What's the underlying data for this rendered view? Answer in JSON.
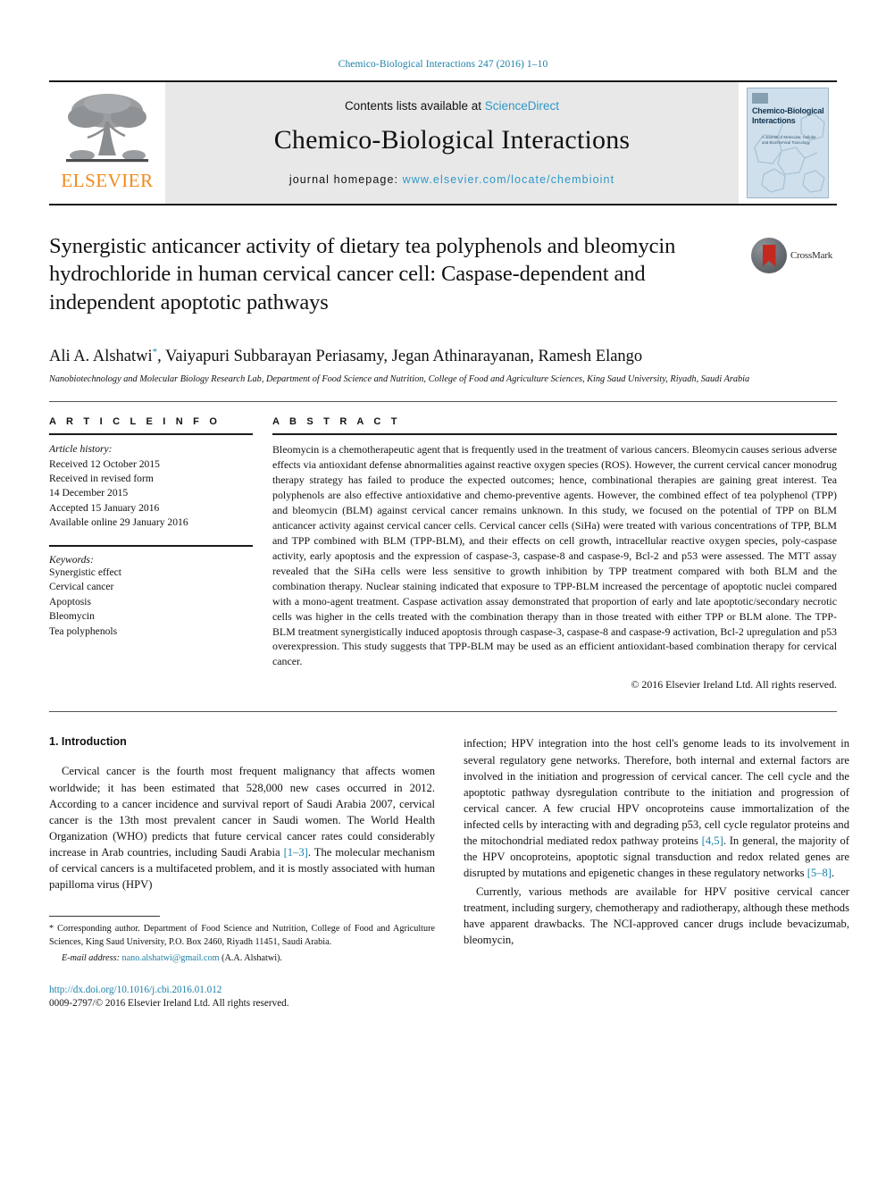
{
  "running_head": "Chemico-Biological Interactions 247 (2016) 1–10",
  "masthead": {
    "contents_prefix": "Contents lists available at ",
    "sciencedirect": "ScienceDirect",
    "journal_name": "Chemico-Biological Interactions",
    "homepage_prefix": "journal homepage: ",
    "homepage_url": "www.elsevier.com/locate/chembioint",
    "publisher": "ELSEVIER",
    "cover_title": "Chemico-Biological Interactions",
    "cover_subtitle": "A Journal of Molecular, Cellular and Biochemical Toxicology",
    "link_color": "#2f97c7",
    "publisher_color": "#f08a1a"
  },
  "article": {
    "title": "Synergistic anticancer activity of dietary tea polyphenols and bleomycin hydrochloride in human cervical cancer cell: Caspase-dependent and independent apoptotic pathways",
    "authors": "Ali A. Alshatwi, Vaiyapuri Subbarayan Periasamy, Jegan Athinarayanan, Ramesh Elango",
    "author_marker": "*",
    "affiliation": "Nanobiotechnology and Molecular Biology Research Lab, Department of Food Science and Nutrition, College of Food and Agriculture Sciences, King Saud University, Riyadh, Saudi Arabia",
    "crossmark_label": "CrossMark"
  },
  "article_info": {
    "heading": "A R T I C L E   I N F O",
    "history_label": "Article history:",
    "history": [
      "Received 12 October 2015",
      "Received in revised form",
      "14 December 2015",
      "Accepted 15 January 2016",
      "Available online 29 January 2016"
    ],
    "keywords_label": "Keywords:",
    "keywords": [
      "Synergistic effect",
      "Cervical cancer",
      "Apoptosis",
      "Bleomycin",
      "Tea polyphenols"
    ]
  },
  "abstract": {
    "heading": "A B S T R A C T",
    "text": "Bleomycin is a chemotherapeutic agent that is frequently used in the treatment of various cancers. Bleomycin causes serious adverse effects via antioxidant defense abnormalities against reactive oxygen species (ROS). However, the current cervical cancer monodrug therapy strategy has failed to produce the expected outcomes; hence, combinational therapies are gaining great interest. Tea polyphenols are also effective antioxidative and chemo-preventive agents. However, the combined effect of tea polyphenol (TPP) and bleomycin (BLM) against cervical cancer remains unknown. In this study, we focused on the potential of TPP on BLM anticancer activity against cervical cancer cells. Cervical cancer cells (SiHa) were treated with various concentrations of TPP, BLM and TPP combined with BLM (TPP-BLM), and their effects on cell growth, intracellular reactive oxygen species, poly-caspase activity, early apoptosis and the expression of caspase-3, caspase-8 and caspase-9, Bcl-2 and p53 were assessed. The MTT assay revealed that the SiHa cells were less sensitive to growth inhibition by TPP treatment compared with both BLM and the combination therapy. Nuclear staining indicated that exposure to TPP-BLM increased the percentage of apoptotic nuclei compared with a mono-agent treatment. Caspase activation assay demonstrated that proportion of early and late apoptotic/secondary necrotic cells was higher in the cells treated with the combination therapy than in those treated with either TPP or BLM alone. The TPP-BLM treatment synergistically induced apoptosis through caspase-3, caspase-8 and caspase-9 activation, Bcl-2 upregulation and p53 overexpression. This study suggests that TPP-BLM may be used as an efficient antioxidant-based combination therapy for cervical cancer.",
    "copyright": "© 2016 Elsevier Ireland Ltd. All rights reserved."
  },
  "introduction": {
    "heading": "1. Introduction",
    "left_para_1": "Cervical cancer is the fourth most frequent malignancy that affects women worldwide; it has been estimated that 528,000 new cases occurred in 2012. According to a cancer incidence and survival report of Saudi Arabia 2007, cervical cancer is the 13th most prevalent cancer in Saudi women. The World Health Organization (WHO) predicts that future cervical cancer rates could considerably increase in Arab countries, including Saudi Arabia ",
    "left_ref_1": "[1–3]",
    "left_para_1b": ". The molecular mechanism of cervical cancers is a multifaceted problem, and it is mostly associated with human papilloma virus (HPV)",
    "right_para_1": "infection; HPV integration into the host cell's genome leads to its involvement in several regulatory gene networks. Therefore, both internal and external factors are involved in the initiation and progression of cervical cancer. The cell cycle and the apoptotic pathway dysregulation contribute to the initiation and progression of cervical cancer. A few crucial HPV oncoproteins cause immortalization of the infected cells by interacting with and degrading p53, cell cycle regulator proteins and the mitochondrial mediated redox pathway proteins ",
    "right_ref_1": "[4,5]",
    "right_para_1b": ". In general, the majority of the HPV oncoproteins, apoptotic signal transduction and redox related genes are disrupted by mutations and epigenetic changes in these regulatory networks ",
    "right_ref_2": "[5–8]",
    "right_para_1c": ".",
    "right_para_2": "Currently, various methods are available for HPV positive cervical cancer treatment, including surgery, chemotherapy and radiotherapy, although these methods have apparent drawbacks. The NCI-approved cancer drugs include bevacizumab, bleomycin,"
  },
  "footnotes": {
    "corresponding_marker": "*",
    "corresponding": " Corresponding author. Department of Food Science and Nutrition, College of Food and Agriculture Sciences, King Saud University, P.O. Box 2460, Riyadh 11451, Saudi Arabia.",
    "email_label": "E-mail address:",
    "email": "nano.alshatwi@gmail.com",
    "email_owner": "(A.A. Alshatwi).",
    "doi": "http://dx.doi.org/10.1016/j.cbi.2016.01.012",
    "issn_line": "0009-2797/© 2016 Elsevier Ireland Ltd. All rights reserved."
  }
}
